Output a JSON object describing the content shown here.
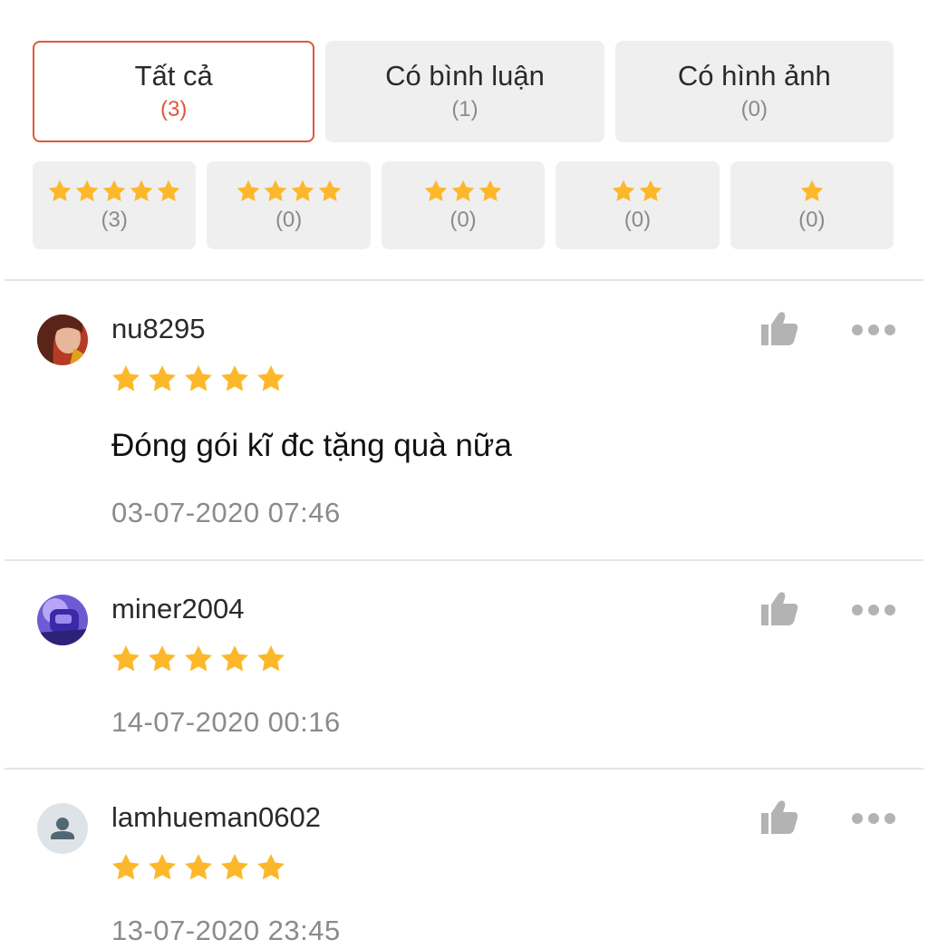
{
  "filter_tabs": [
    {
      "label": "Tất cả",
      "count": "(3)"
    },
    {
      "label": "Có bình luận",
      "count": "(1)"
    },
    {
      "label": "Có hình ảnh",
      "count": "(0)"
    }
  ],
  "star_filters": [
    {
      "stars": 5,
      "count": "(3)"
    },
    {
      "stars": 4,
      "count": "(0)"
    },
    {
      "stars": 3,
      "count": "(0)"
    },
    {
      "stars": 2,
      "count": "(0)"
    },
    {
      "stars": 1,
      "count": "(0)"
    }
  ],
  "reviews": [
    {
      "username": "nu8295",
      "rating": 5,
      "comment": "Đóng gói kĩ đc tặng quà nữa",
      "date": "03-07-2020 07:46"
    },
    {
      "username": "miner2004",
      "rating": 5,
      "date": "14-07-2020 00:16"
    },
    {
      "username": "lamhueman0602",
      "rating": 5,
      "date": "13-07-2020 23:45"
    }
  ],
  "colors": {
    "accent": "#e2553a",
    "star": "#fcb82a"
  },
  "icons": {
    "like": "thumbs-up-icon",
    "more": "more-options-icon",
    "default_avatar": "user-icon"
  }
}
